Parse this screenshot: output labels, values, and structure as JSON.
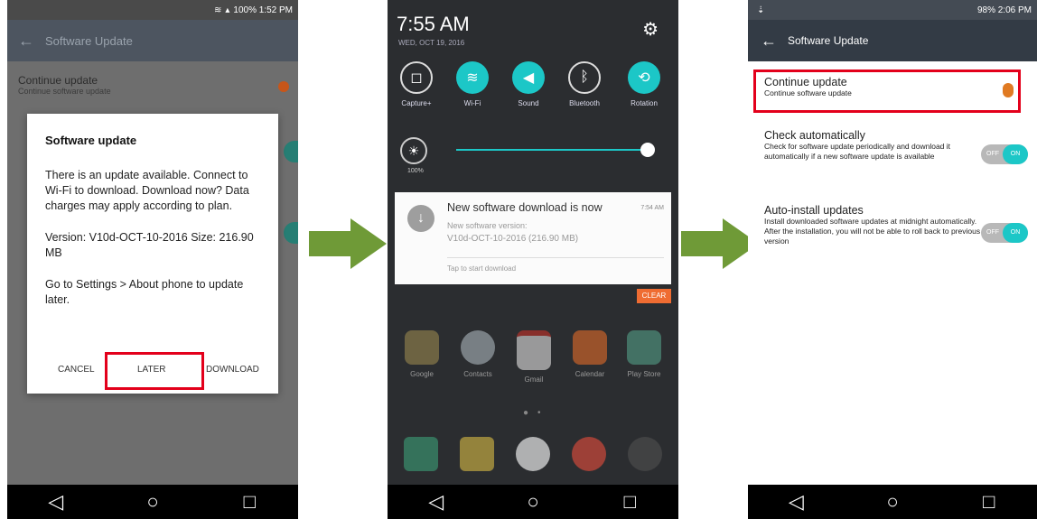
{
  "nav": {
    "back": "◁",
    "home": "○",
    "recent": "□"
  },
  "phone1": {
    "status": "100%  1:52 PM",
    "toolbar_title": "Software Update",
    "bg_row_title": "Continue update",
    "bg_row_sub": "Continue software update",
    "dialog": {
      "title": "Software update",
      "para1": "There is an update available. Connect to Wi-Fi to download. Download now? Data charges may apply according to plan.",
      "para2": "Version: V10d-OCT-10-2016 Size: 216.90 MB",
      "para3": "Go to Settings > About phone to update later.",
      "cancel": "CANCEL",
      "later": "LATER",
      "download": "DOWNLOAD"
    }
  },
  "phone2": {
    "time": "7:55 AM",
    "date": "WED, OCT 19, 2016",
    "tiles": [
      "Capture+",
      "Wi-Fi",
      "Sound",
      "Bluetooth",
      "Rotation"
    ],
    "brightness": "100%",
    "notification": {
      "title": "New software download is now",
      "time": "7:54 AM",
      "line1": "New software version:",
      "line2": "V10d-OCT-10-2016 (216.90 MB)",
      "action": "Tap to start download"
    },
    "clear": "CLEAR",
    "apps": [
      "Google",
      "Contacts",
      "Gmail",
      "Calendar",
      "Play Store"
    ]
  },
  "phone3": {
    "status": "98%  2:06 PM",
    "toolbar_title": "Software Update",
    "continue": {
      "title": "Continue update",
      "sub": "Continue software update"
    },
    "check": {
      "title": "Check automatically",
      "sub": "Check for software update periodically and download it automatically if a new software update is available",
      "off": "OFF",
      "on": "ON"
    },
    "auto": {
      "title": "Auto-install updates",
      "sub": "Install downloaded software updates at midnight automatically. After the installation, you will not be able to roll back to previous version",
      "off": "OFF",
      "on": "ON"
    }
  },
  "colors": {
    "highlight": "#e3001b",
    "arrow": "#6f9a37",
    "teal": "#1cc7c7"
  }
}
